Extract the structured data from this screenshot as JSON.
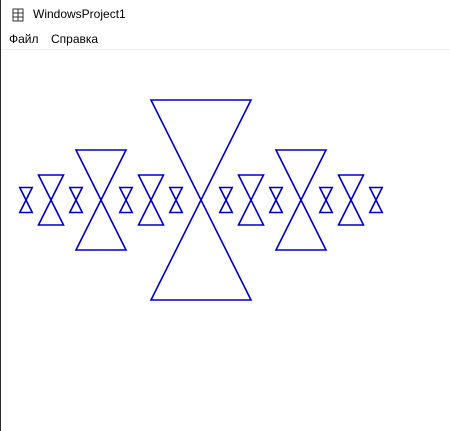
{
  "window": {
    "title": "WindowsProject1",
    "icon": "app-window-icon"
  },
  "menu": {
    "items": [
      {
        "label": "Файл"
      },
      {
        "label": "Справка"
      }
    ]
  },
  "canvas": {
    "drawing": "recursive-bowtie-fractal",
    "stroke_color": "#0000cc",
    "background": "#ffffff",
    "recursion_depth": 4
  }
}
